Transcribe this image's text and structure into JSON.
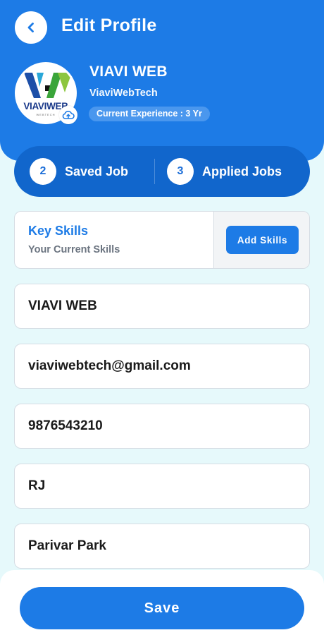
{
  "header": {
    "title": "Edit Profile",
    "back_icon": "chevron-left-icon"
  },
  "profile": {
    "logo_text": "VIAVIWEB",
    "logo_tagline": "WEBTECH",
    "name": "VIAVI WEB",
    "handle": "ViaviWebTech",
    "experience": "Current Experience : 3 Yr",
    "upload_icon": "cloud-upload-icon"
  },
  "stats": [
    {
      "count": "2",
      "label": "Saved Job"
    },
    {
      "count": "3",
      "label": "Applied Jobs"
    }
  ],
  "skills": {
    "title": "Key Skills",
    "subtitle": "Your Current Skills",
    "button_label": "Add Skills"
  },
  "fields": {
    "name": "VIAVI WEB",
    "email": "viaviwebtech@gmail.com",
    "phone": "9876543210",
    "state": "RJ",
    "address": "Parivar Park"
  },
  "footer": {
    "save_label": "Save"
  },
  "colors": {
    "primary": "#1d7be6",
    "stats_bar": "#1166cc",
    "background": "#e6f9fb"
  }
}
